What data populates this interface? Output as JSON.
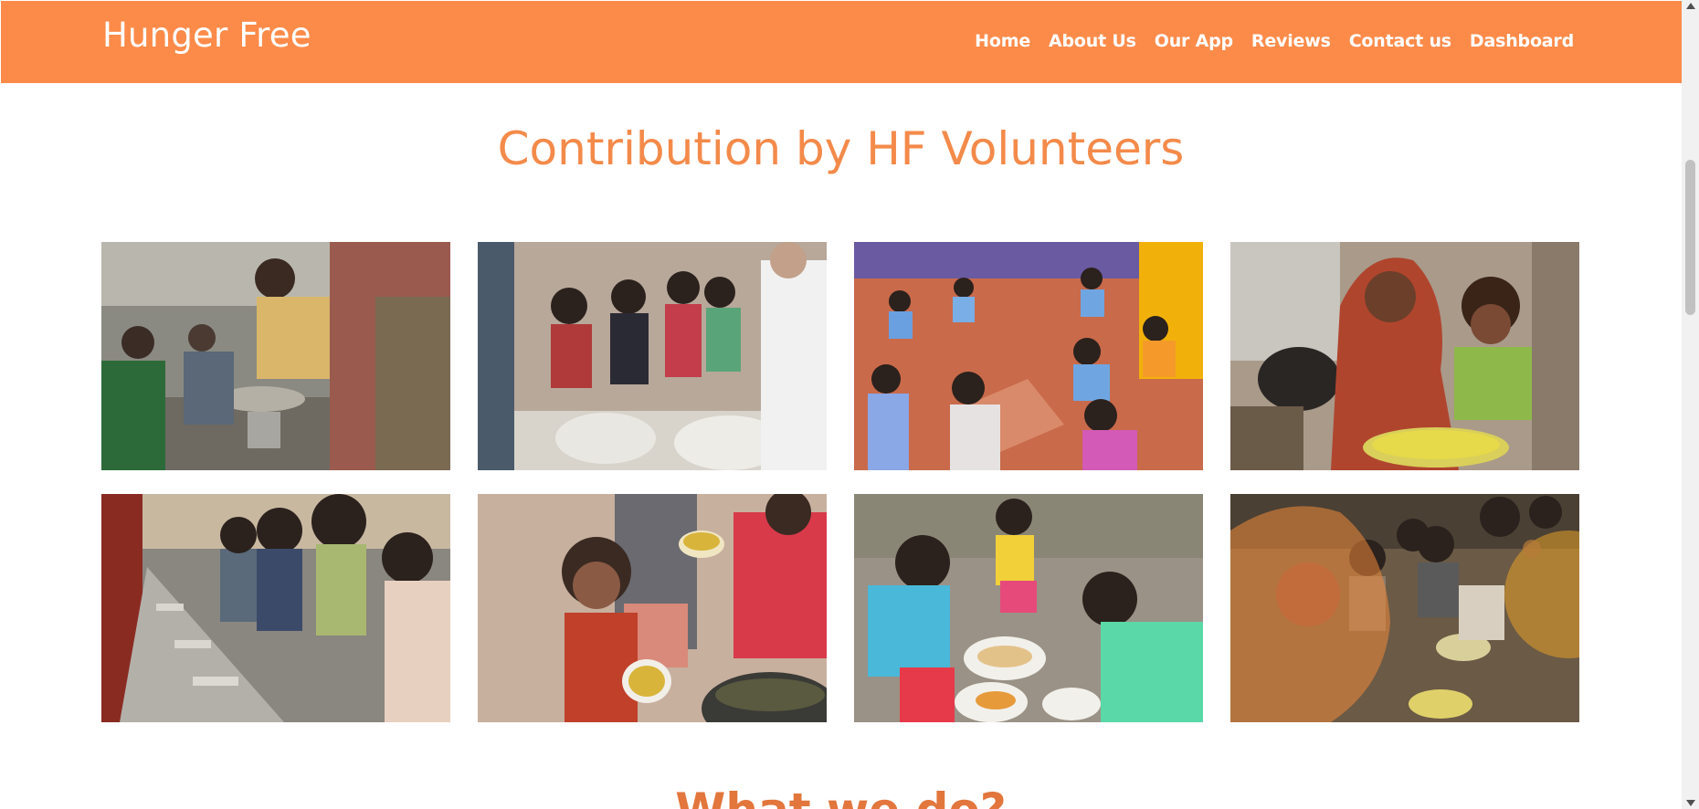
{
  "header": {
    "brand": "Hunger Free",
    "nav": [
      "Home",
      "About Us",
      "Our App",
      "Reviews",
      "Contact us",
      "Dashboard"
    ],
    "background_color": "#fc8b4a"
  },
  "main": {
    "section_title": "Contribution by HF Volunteers",
    "next_section_title": "What we do?",
    "accent_color": "#f48a4a",
    "gallery": [
      {
        "scene": "volunteers-serving-food-from-pots"
      },
      {
        "scene": "children-with-bowls-at-food-counter"
      },
      {
        "scene": "students-eating-on-floor"
      },
      {
        "scene": "mother-holding-child-with-rice-plate"
      },
      {
        "scene": "children-seated-in-row-with-plates"
      },
      {
        "scene": "child-holding-bowl-of-food"
      },
      {
        "scene": "children-eating-outdoors"
      },
      {
        "scene": "children-eating-with-orange-overlay"
      }
    ]
  }
}
